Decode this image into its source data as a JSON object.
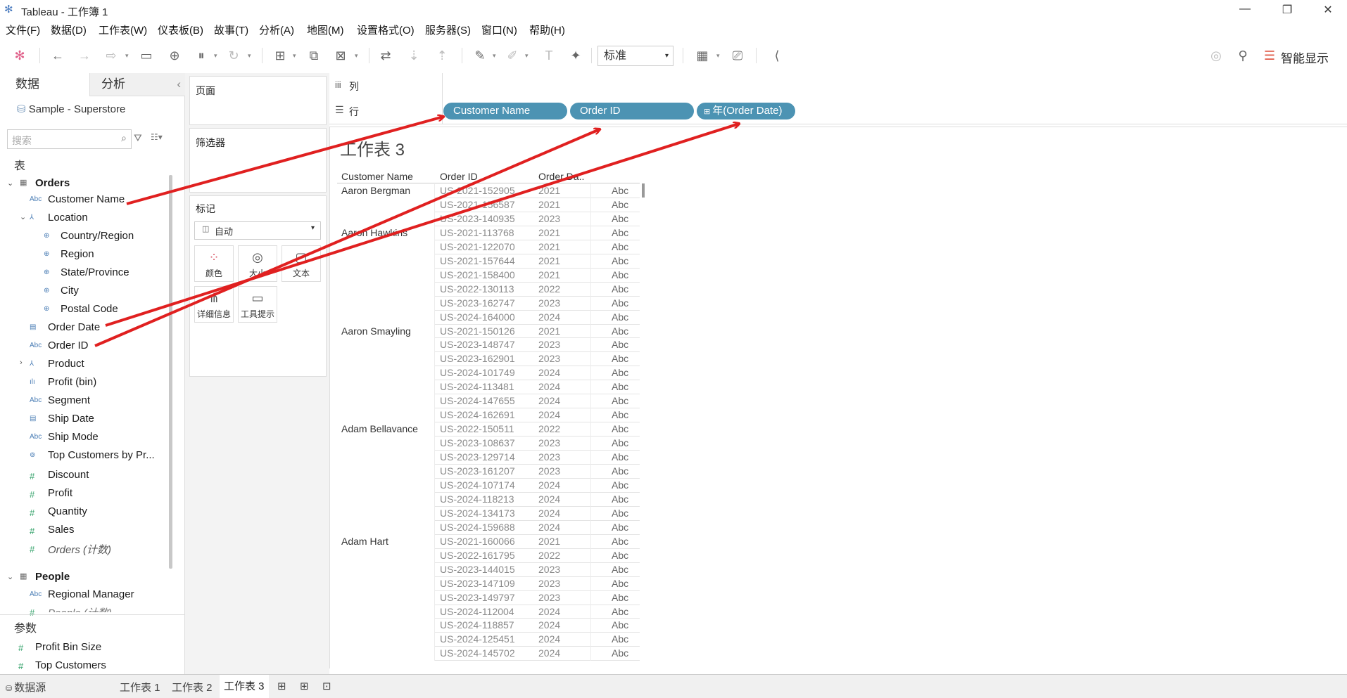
{
  "window": {
    "title": "Tableau - 工作簿 1"
  },
  "menu": [
    "文件(F)",
    "数据(D)",
    "工作表(W)",
    "仪表板(B)",
    "故事(T)",
    "分析(A)",
    "地图(M)",
    "设置格式(O)",
    "服务器(S)",
    "窗口(N)",
    "帮助(H)"
  ],
  "toolbar": {
    "fit_select": "标准",
    "show_me": "智能显示"
  },
  "left": {
    "tab_data": "数据",
    "tab_analysis": "分析",
    "datasource": "Sample - Superstore",
    "search_placeholder": "搜索",
    "tables_heading": "表",
    "orders_table": "Orders",
    "orders_fields": [
      {
        "label": "Customer Name",
        "icon": "Abc",
        "indent": 1
      },
      {
        "label": "Location",
        "icon": "hier",
        "indent": 1
      },
      {
        "label": "Country/Region",
        "icon": "globe",
        "indent": 2
      },
      {
        "label": "Region",
        "icon": "globe",
        "indent": 2
      },
      {
        "label": "State/Province",
        "icon": "globe",
        "indent": 2
      },
      {
        "label": "City",
        "icon": "globe",
        "indent": 2
      },
      {
        "label": "Postal Code",
        "icon": "globe",
        "indent": 2
      },
      {
        "label": "Order Date",
        "icon": "date",
        "indent": 1
      },
      {
        "label": "Order ID",
        "icon": "Abc",
        "indent": 1
      },
      {
        "label": "Product",
        "icon": "hier",
        "indent": 1
      },
      {
        "label": "Profit (bin)",
        "icon": "bin",
        "indent": 1
      },
      {
        "label": "Segment",
        "icon": "Abc",
        "indent": 1
      },
      {
        "label": "Ship Date",
        "icon": "date",
        "indent": 1
      },
      {
        "label": "Ship Mode",
        "icon": "Abc",
        "indent": 1
      },
      {
        "label": "Top Customers by Pr...",
        "icon": "set",
        "indent": 1
      },
      {
        "label": "Discount",
        "icon": "#",
        "indent": 1
      },
      {
        "label": "Profit",
        "icon": "#",
        "indent": 1
      },
      {
        "label": "Quantity",
        "icon": "#",
        "indent": 1
      },
      {
        "label": "Sales",
        "icon": "#",
        "indent": 1
      },
      {
        "label": "Orders (计数)",
        "icon": "#",
        "indent": 1
      }
    ],
    "people_table": "People",
    "people_fields": [
      {
        "label": "Regional Manager",
        "icon": "Abc"
      },
      {
        "label": "People (计数)",
        "icon": "#"
      }
    ],
    "params_heading": "参数",
    "params": [
      "Profit Bin Size",
      "Top Customers"
    ]
  },
  "shelves": {
    "pages": "页面",
    "filters": "筛选器",
    "marks": "标记",
    "mark_type": "自动",
    "mark_buttons": [
      "颜色",
      "大小",
      "文本",
      "详细信息",
      "工具提示"
    ]
  },
  "columns_label": "列",
  "rows_label": "行",
  "row_pills": [
    "Customer Name",
    "Order ID",
    "年(Order Date)"
  ],
  "view": {
    "sheet_title": "工作表 3",
    "headers": [
      "Customer Name",
      "Order ID",
      "Order Da.."
    ],
    "cell_text": "Abc",
    "rows": [
      [
        "Aaron Bergman",
        "US-2021-152905",
        "2021"
      ],
      [
        "",
        "US-2021-156587",
        "2021"
      ],
      [
        "",
        "US-2023-140935",
        "2023"
      ],
      [
        "Aaron Hawkins",
        "US-2021-113768",
        "2021"
      ],
      [
        "",
        "US-2021-122070",
        "2021"
      ],
      [
        "",
        "US-2021-157644",
        "2021"
      ],
      [
        "",
        "US-2021-158400",
        "2021"
      ],
      [
        "",
        "US-2022-130113",
        "2022"
      ],
      [
        "",
        "US-2023-162747",
        "2023"
      ],
      [
        "",
        "US-2024-164000",
        "2024"
      ],
      [
        "Aaron Smayling",
        "US-2021-150126",
        "2021"
      ],
      [
        "",
        "US-2023-148747",
        "2023"
      ],
      [
        "",
        "US-2023-162901",
        "2023"
      ],
      [
        "",
        "US-2024-101749",
        "2024"
      ],
      [
        "",
        "US-2024-113481",
        "2024"
      ],
      [
        "",
        "US-2024-147655",
        "2024"
      ],
      [
        "",
        "US-2024-162691",
        "2024"
      ],
      [
        "Adam Bellavance",
        "US-2022-150511",
        "2022"
      ],
      [
        "",
        "US-2023-108637",
        "2023"
      ],
      [
        "",
        "US-2023-129714",
        "2023"
      ],
      [
        "",
        "US-2023-161207",
        "2023"
      ],
      [
        "",
        "US-2024-107174",
        "2024"
      ],
      [
        "",
        "US-2024-118213",
        "2024"
      ],
      [
        "",
        "US-2024-134173",
        "2024"
      ],
      [
        "",
        "US-2024-159688",
        "2024"
      ],
      [
        "Adam Hart",
        "US-2021-160066",
        "2021"
      ],
      [
        "",
        "US-2022-161795",
        "2022"
      ],
      [
        "",
        "US-2023-144015",
        "2023"
      ],
      [
        "",
        "US-2023-147109",
        "2023"
      ],
      [
        "",
        "US-2023-149797",
        "2023"
      ],
      [
        "",
        "US-2024-112004",
        "2024"
      ],
      [
        "",
        "US-2024-118857",
        "2024"
      ],
      [
        "",
        "US-2024-125451",
        "2024"
      ],
      [
        "",
        "US-2024-145702",
        "2024"
      ]
    ]
  },
  "bottom": {
    "datasource_tab": "数据源",
    "sheets": [
      "工作表 1",
      "工作表 2",
      "工作表 3"
    ]
  },
  "colors": {
    "pill": "#4c93b3",
    "annotation_arrow": "#e02020"
  }
}
